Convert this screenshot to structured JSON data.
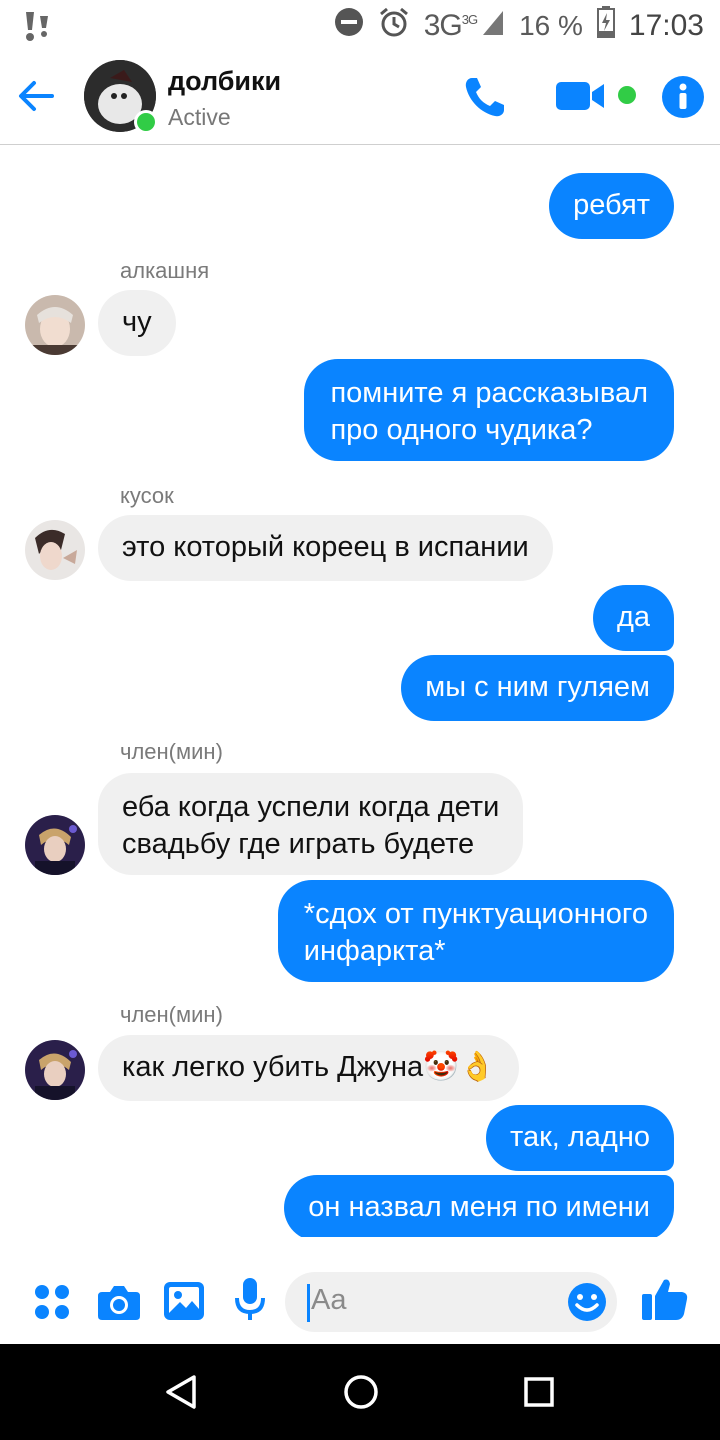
{
  "status_bar": {
    "network": "3G",
    "network_sup": "3G",
    "battery_percent": "16 %",
    "time": "17:03",
    "icons": [
      "notification-icon",
      "do-not-disturb-icon",
      "alarm-icon",
      "signal-icon",
      "battery-charging-icon"
    ]
  },
  "header": {
    "title": "долбики",
    "subtitle": "Active",
    "icons": [
      "back-arrow-icon",
      "phone-icon",
      "video-camera-icon",
      "info-icon"
    ]
  },
  "messages": [
    {
      "dir": "out",
      "text": "ребят"
    },
    {
      "dir": "in",
      "sender": "алкашня",
      "text": "чу"
    },
    {
      "dir": "out",
      "lines": [
        "помните я рассказывал",
        "про одного чудика?"
      ]
    },
    {
      "dir": "in",
      "sender": "кусок",
      "text": "это который кореец в испании"
    },
    {
      "dir": "out",
      "text": "да"
    },
    {
      "dir": "out",
      "text": "мы с ним гуляем"
    },
    {
      "dir": "in",
      "sender": "член(мин)",
      "lines": [
        "еба когда успели когда дети",
        "свадьбу где играть будете"
      ]
    },
    {
      "dir": "out",
      "lines": [
        "*сдох от пунктуационного",
        "инфаркта*"
      ]
    },
    {
      "dir": "in",
      "sender": "член(мин)",
      "text": "как легко убить Джуна",
      "emoji": [
        "🤡",
        "👌"
      ]
    },
    {
      "dir": "out",
      "text": "так, ладно"
    },
    {
      "dir": "out",
      "text": "он назвал меня по имени"
    }
  ],
  "composer": {
    "placeholder": "Aa",
    "icons": [
      "apps-icon",
      "camera-icon",
      "gallery-icon",
      "microphone-icon",
      "emoji-icon",
      "like-icon"
    ]
  },
  "colors": {
    "accent": "#0a84ff",
    "incoming_bubble": "#f0f0f0",
    "online": "#31cc46"
  }
}
